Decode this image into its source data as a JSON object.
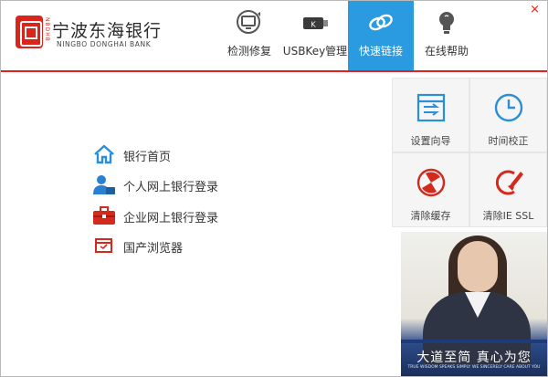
{
  "window": {
    "close_glyph": "×",
    "accent": "#e0211f",
    "active_color": "#2a9be0"
  },
  "logo": {
    "cn": "宁波东海银行",
    "en": "NINGBO DONGHAI BANK",
    "side": "NBDHB",
    "mark_icon": "fu-seal-icon"
  },
  "nav": [
    {
      "label": "检测修复",
      "icon": "monitor-repair-icon",
      "active": false
    },
    {
      "label": "USBKey管理",
      "icon": "usb-key-icon",
      "active": false
    },
    {
      "label": "快速链接",
      "icon": "link-icon",
      "active": true
    },
    {
      "label": "在线帮助",
      "icon": "lightbulb-icon",
      "active": false
    }
  ],
  "usb_key_glyph": "K",
  "links": [
    {
      "label": "银行首页",
      "icon": "home-icon"
    },
    {
      "label": "个人网上银行登录",
      "icon": "person-icon"
    },
    {
      "label": "企业网上银行登录",
      "icon": "briefcase-icon"
    },
    {
      "label": "国产浏览器",
      "icon": "browser-icon"
    }
  ],
  "tiles": [
    {
      "label": "设置向导",
      "icon": "setup-wizard-icon"
    },
    {
      "label": "时间校正",
      "icon": "clock-icon"
    },
    {
      "label": "清除缓存",
      "icon": "clear-cache-icon"
    },
    {
      "label": "清除IE SSL",
      "icon": "clear-ssl-icon"
    }
  ],
  "ad": {
    "slogan": "大道至简  真心为您",
    "sub": "TRUE WISDOM SPEAKS SIMPLY. WE SINCERELY CARE ABOUT YOU"
  }
}
